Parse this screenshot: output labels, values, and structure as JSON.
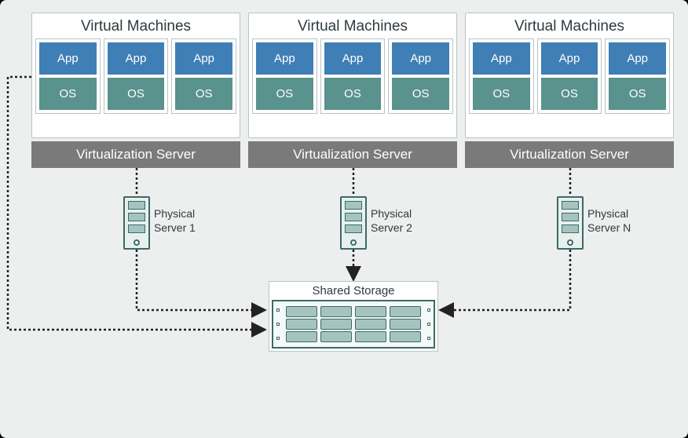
{
  "diagram": {
    "vm_groups": [
      {
        "title": "Virtual Machines",
        "apps": [
          "App",
          "App",
          "App"
        ],
        "oss": [
          "OS",
          "OS",
          "OS"
        ]
      },
      {
        "title": "Virtual Machines",
        "apps": [
          "App",
          "App",
          "App"
        ],
        "oss": [
          "OS",
          "OS",
          "OS"
        ]
      },
      {
        "title": "Virtual Machines",
        "apps": [
          "App",
          "App",
          "App"
        ],
        "oss": [
          "OS",
          "OS",
          "OS"
        ]
      }
    ],
    "virtualization_servers": [
      "Virtualization  Server",
      "Virtualization  Server",
      "Virtualization  Server"
    ],
    "physical_servers": [
      {
        "label_line1": "Physical",
        "label_line2": "Server 1"
      },
      {
        "label_line1": "Physical",
        "label_line2": "Server 2"
      },
      {
        "label_line1": "Physical",
        "label_line2": "Server N"
      }
    ],
    "shared_storage": "Shared Storage"
  },
  "colors": {
    "app": "#3f7fb5",
    "os": "#5a928d",
    "virt_server_bg": "#7a7a7a",
    "storage_accent": "#3b6a66",
    "canvas_bg": "#edeeee"
  }
}
